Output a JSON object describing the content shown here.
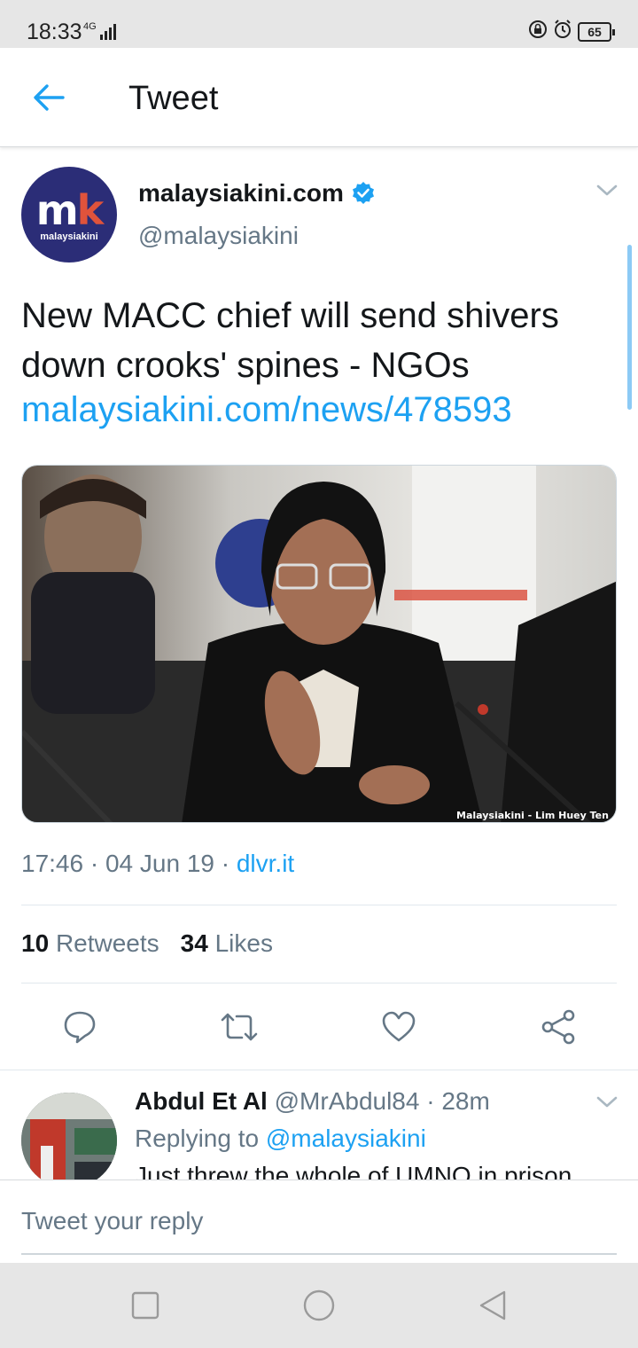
{
  "status_bar": {
    "time": "18:33",
    "network": "4G",
    "battery": "65",
    "icons": [
      "lock-rotation-icon",
      "alarm-icon",
      "battery-icon"
    ]
  },
  "header": {
    "back_icon": "arrow-left-icon",
    "title": "Tweet"
  },
  "tweet": {
    "avatar_logo": "mk",
    "avatar_label": "malaysiakini",
    "display_name": "malaysiakini.com",
    "verified_icon": "verified-badge-icon",
    "handle": "@malaysiakini",
    "text": "New MACC chief will send shivers down crooks' spines - NGOs",
    "link": "malaysiakini.com/news/478593",
    "media_caption": "Malaysiakini - Lim Huey Ten",
    "time": "17:46",
    "date": "04 Jun 19",
    "source": "dlvr.it",
    "retweets_count": "10",
    "retweets_label": "Retweets",
    "likes_count": "34",
    "likes_label": "Likes"
  },
  "actions": [
    "reply-icon",
    "retweet-icon",
    "like-icon",
    "share-icon"
  ],
  "reply": {
    "display_name": "Abdul Et Al",
    "handle": "@MrAbdul84",
    "time": "28m",
    "replying_prefix": "Replying to",
    "replying_to": "@malaysiakini",
    "text": "Just threw the whole of UMNO in prison"
  },
  "composer": {
    "placeholder": "Tweet your reply"
  },
  "colors": {
    "accent": "#1da1f2",
    "text_primary": "#14171a",
    "text_secondary": "#657786",
    "brand_avatar": "#2b2d77"
  }
}
